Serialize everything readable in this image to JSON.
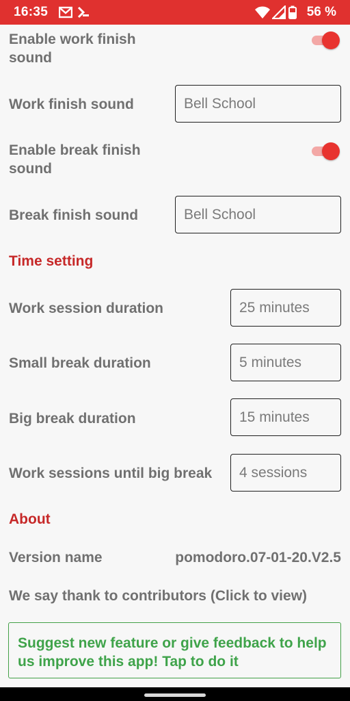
{
  "status_bar": {
    "time": "16:35",
    "battery": "56 %",
    "icons": [
      "gmail-icon",
      "notification-icon",
      "wifi-icon",
      "signal-icon",
      "battery-icon"
    ],
    "color": "#e0312f"
  },
  "settings": {
    "enable_work_finish_sound": {
      "label": "Enable work finish sound",
      "enabled": true
    },
    "work_finish_sound": {
      "label": "Work finish sound",
      "value": "Bell School"
    },
    "enable_break_finish_sound": {
      "label": "Enable break finish sound",
      "enabled": true
    },
    "break_finish_sound": {
      "label": "Break finish sound",
      "value": "Bell School"
    }
  },
  "time_setting": {
    "title": "Time setting",
    "work_session_duration": {
      "label": "Work session duration",
      "value": "25 minutes"
    },
    "small_break_duration": {
      "label": "Small break duration",
      "value": "5 minutes"
    },
    "big_break_duration": {
      "label": "Big break duration",
      "value": "15 minutes"
    },
    "sessions_until_big_break": {
      "label": "Work sessions until big break",
      "value": "4 sessions"
    }
  },
  "about": {
    "title": "About",
    "version_label": "Version name",
    "version_value": "pomodoro.07-01-20.V2.5",
    "contributors_text": "We say thank to contributors (Click to view)",
    "feedback_text": "Suggest new feature or give feedback to help us improve this app! Tap to do it"
  },
  "colors": {
    "accent": "#e8332f",
    "section_title": "#c62828",
    "feedback_green": "#3fa34a",
    "label_gray": "#707070"
  }
}
